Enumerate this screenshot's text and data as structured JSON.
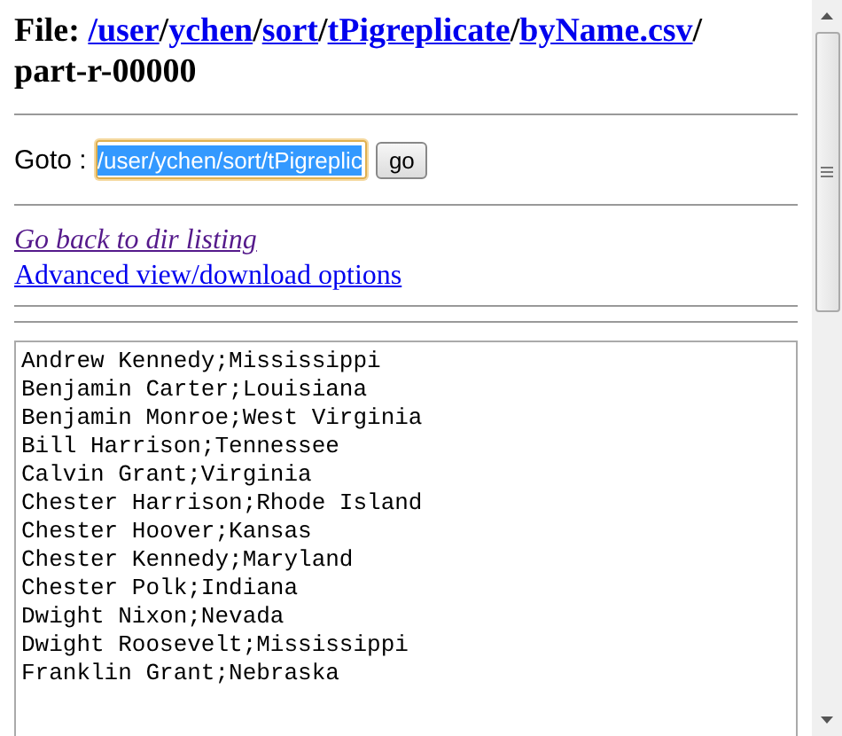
{
  "heading": {
    "label": "File:",
    "path": [
      {
        "kind": "link",
        "text": "/user"
      },
      {
        "kind": "text",
        "text": "/"
      },
      {
        "kind": "link",
        "text": "ychen"
      },
      {
        "kind": "text",
        "text": "/"
      },
      {
        "kind": "link",
        "text": "sort"
      },
      {
        "kind": "text",
        "text": "/"
      },
      {
        "kind": "link",
        "text": "tPigreplicate"
      },
      {
        "kind": "text",
        "text": "/"
      },
      {
        "kind": "link",
        "text": "byName.csv"
      },
      {
        "kind": "text",
        "text": "/"
      },
      {
        "kind": "text",
        "text": "part-r-"
      },
      {
        "kind": "text",
        "text": "00000"
      }
    ]
  },
  "goto": {
    "label": "Goto :",
    "value": "/user/ychen/sort/tPigreplic",
    "text_selected": true,
    "button": "go"
  },
  "links": [
    {
      "text": "Go back to dir listing",
      "visited": true
    },
    {
      "text": "Advanced view/download options",
      "visited": false
    }
  ],
  "file_lines": [
    "Andrew Kennedy;Mississippi",
    "Benjamin Carter;Louisiana",
    "Benjamin Monroe;West Virginia",
    "Bill Harrison;Tennessee",
    "Calvin Grant;Virginia",
    "Chester Harrison;Rhode Island",
    "Chester Hoover;Kansas",
    "Chester Kennedy;Maryland",
    "Chester Polk;Indiana",
    "Dwight Nixon;Nevada",
    "Dwight Roosevelt;Mississippi",
    "Franklin Grant;Nebraska"
  ]
}
